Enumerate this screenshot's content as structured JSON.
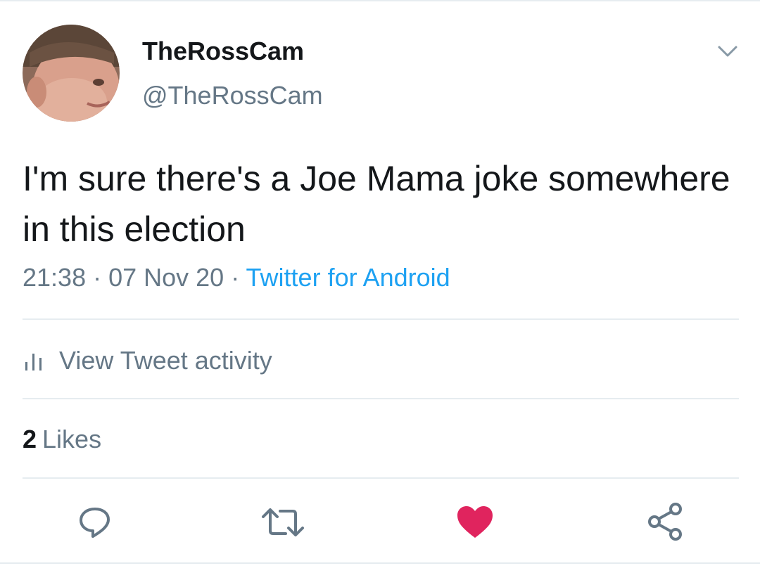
{
  "tweet": {
    "display_name": "TheRossCam",
    "handle": "@TheRossCam",
    "text": "I'm sure there's a Joe Mama joke somewhere in this election",
    "time": "21:38",
    "separator": " · ",
    "date": "07 Nov 20",
    "source": "Twitter for Android"
  },
  "activity": {
    "label": "View Tweet activity",
    "icon": "bar-chart-icon"
  },
  "likes": {
    "count": "2",
    "label": "Likes"
  },
  "actions": {
    "reply_icon": "reply-icon",
    "retweet_icon": "retweet-icon",
    "like_icon": "heart-icon",
    "share_icon": "share-icon"
  },
  "colors": {
    "text": "#14171a",
    "secondary": "#657786",
    "link": "#1da1f2",
    "like": "#e0245e",
    "divider": "#e6ecf0"
  }
}
